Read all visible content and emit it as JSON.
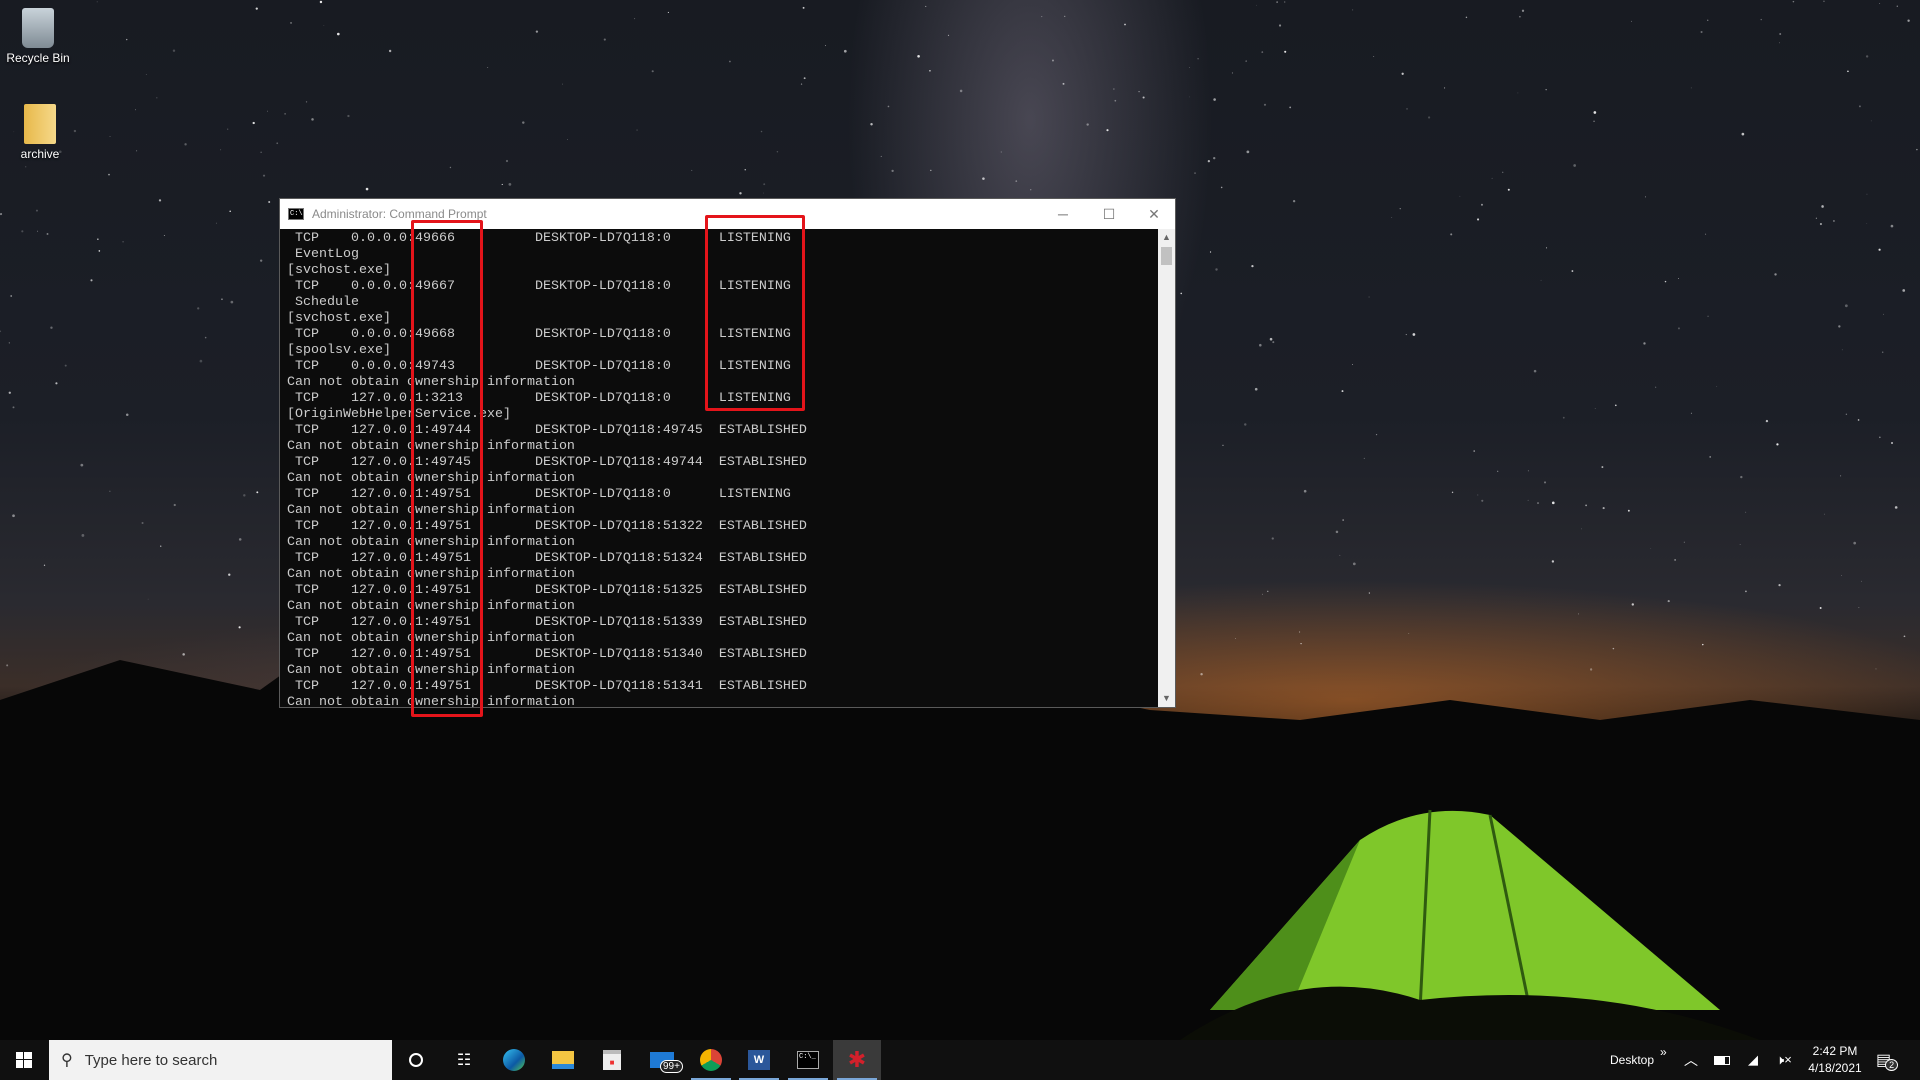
{
  "desktop": {
    "icons": [
      {
        "label": "Recycle Bin",
        "icon": "recycle-bin-icon"
      },
      {
        "label": "archive",
        "icon": "folder-archive-icon"
      }
    ]
  },
  "window": {
    "title": "Administrator: Command Prompt",
    "controls": [
      "minimize",
      "maximize",
      "close"
    ]
  },
  "terminal": {
    "lines": [
      " TCP    0.0.0.0:49666          DESKTOP-LD7Q118:0      LISTENING",
      " EventLog",
      "[svchost.exe]",
      " TCP    0.0.0.0:49667          DESKTOP-LD7Q118:0      LISTENING",
      " Schedule",
      "[svchost.exe]",
      " TCP    0.0.0.0:49668          DESKTOP-LD7Q118:0      LISTENING",
      "[spoolsv.exe]",
      " TCP    0.0.0.0:49743          DESKTOP-LD7Q118:0      LISTENING",
      "Can not obtain ownership information",
      " TCP    127.0.0.1:3213         DESKTOP-LD7Q118:0      LISTENING",
      "[OriginWebHelperService.exe]",
      " TCP    127.0.0.1:49744        DESKTOP-LD7Q118:49745  ESTABLISHED",
      "Can not obtain ownership information",
      " TCP    127.0.0.1:49745        DESKTOP-LD7Q118:49744  ESTABLISHED",
      "Can not obtain ownership information",
      " TCP    127.0.0.1:49751        DESKTOP-LD7Q118:0      LISTENING",
      "Can not obtain ownership information",
      " TCP    127.0.0.1:49751        DESKTOP-LD7Q118:51322  ESTABLISHED",
      "Can not obtain ownership information",
      " TCP    127.0.0.1:49751        DESKTOP-LD7Q118:51324  ESTABLISHED",
      "Can not obtain ownership information",
      " TCP    127.0.0.1:49751        DESKTOP-LD7Q118:51325  ESTABLISHED",
      "Can not obtain ownership information",
      " TCP    127.0.0.1:49751        DESKTOP-LD7Q118:51339  ESTABLISHED",
      "Can not obtain ownership information",
      " TCP    127.0.0.1:49751        DESKTOP-LD7Q118:51340  ESTABLISHED",
      "Can not obtain ownership information",
      " TCP    127.0.0.1:49751        DESKTOP-LD7Q118:51341  ESTABLISHED",
      "Can not obtain ownership information"
    ]
  },
  "annotations": {
    "color": "#e4141a",
    "boxes": [
      "local-port-column",
      "state-column"
    ]
  },
  "taskbar": {
    "search_placeholder": "Type here to search",
    "apps": [
      "cortana",
      "task-view",
      "edge",
      "file-explorer",
      "store",
      "mail",
      "chrome",
      "word",
      "command-prompt",
      "red-app"
    ],
    "mail_badge": "99+",
    "tray": {
      "desktop_label": "Desktop",
      "overflow": "»",
      "time": "2:42 PM",
      "date": "4/18/2021",
      "notifications": "2"
    }
  }
}
